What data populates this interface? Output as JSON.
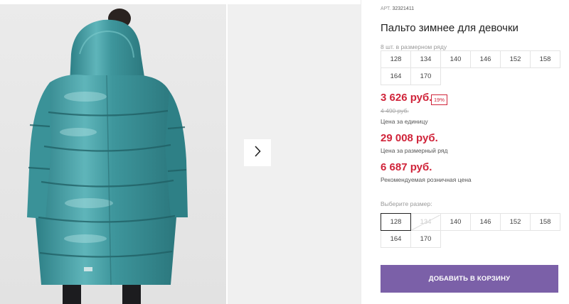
{
  "product": {
    "sku_label": "АРТ.",
    "sku": "32321411",
    "title": "Пальто зимнее для девочки",
    "range_note": "8 шт. в размерном ряду",
    "range_sizes": [
      "128",
      "134",
      "140",
      "146",
      "152",
      "158",
      "164",
      "170"
    ]
  },
  "pricing": {
    "unit_price": "3 626 руб.",
    "discount": "19%",
    "old_price": "4 490 руб.",
    "unit_label": "Цена за единицу",
    "range_price": "29 008 руб.",
    "range_label": "Цена за размерный ряд",
    "retail_price": "6 687 руб.",
    "retail_label": "Рекомендуемая розничная цена"
  },
  "size_picker": {
    "label": "Выберите размер:",
    "sizes": [
      "128",
      "134",
      "140",
      "146",
      "152",
      "158",
      "164",
      "170"
    ],
    "selected": "128",
    "unavailable": [
      "134"
    ]
  },
  "actions": {
    "add_to_cart": "ДОБАВИТЬ В КОРЗИНУ"
  },
  "colors": {
    "price_red": "#d0243a",
    "button_purple": "#7b60a8",
    "coat_teal": "#3f9aa0"
  },
  "icons": {
    "next": "chevron-right-icon"
  }
}
